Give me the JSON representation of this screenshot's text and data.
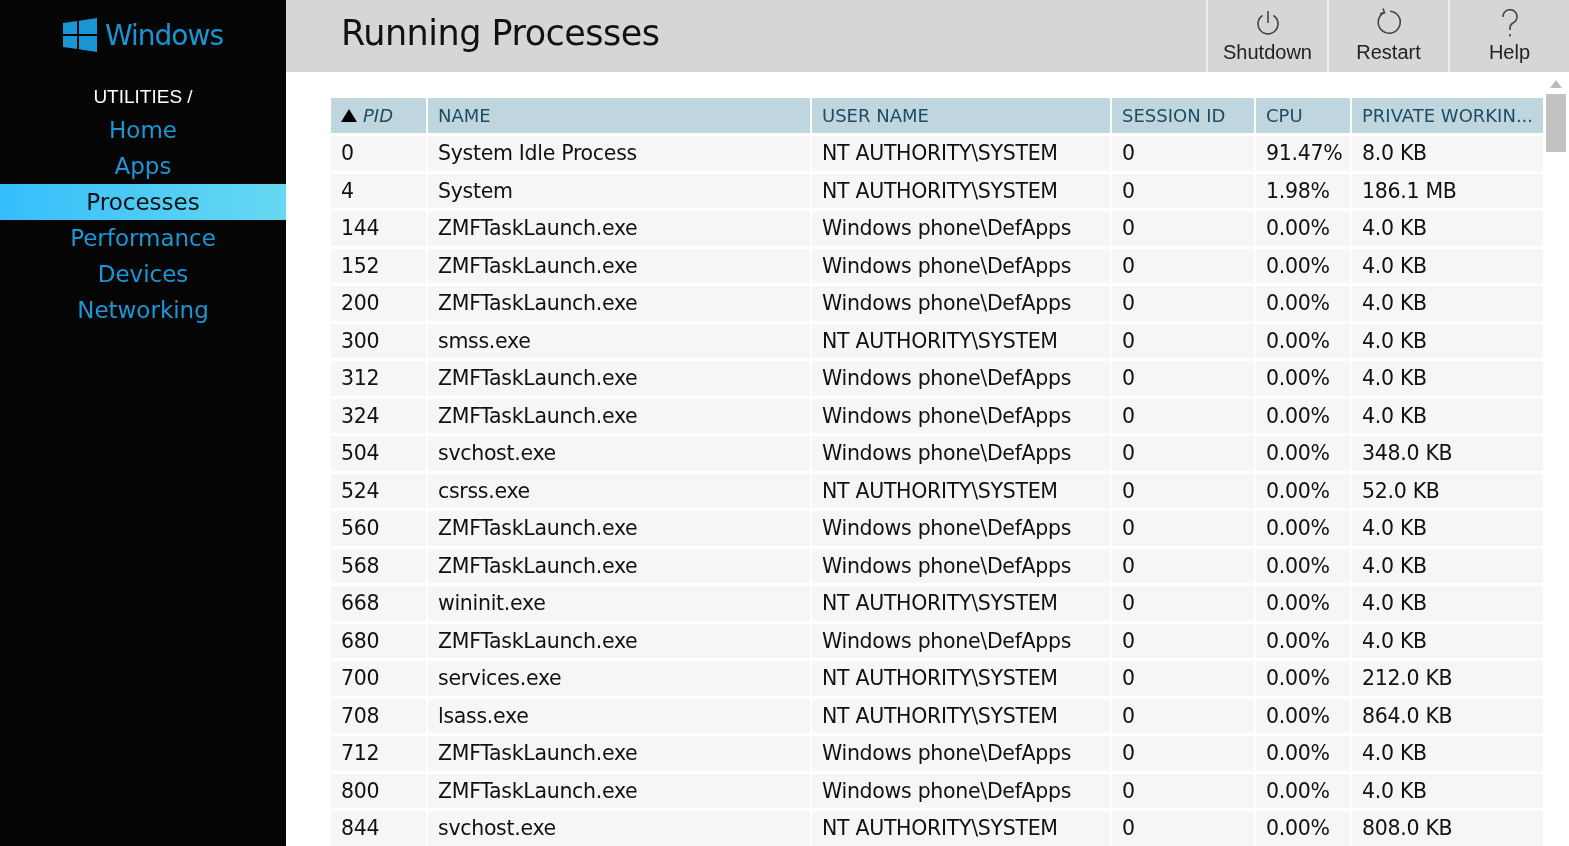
{
  "sidebar": {
    "brand": "Windows",
    "section": "UTILITIES /",
    "items": [
      {
        "label": "Home",
        "selected": false
      },
      {
        "label": "Apps",
        "selected": false
      },
      {
        "label": "Processes",
        "selected": true
      },
      {
        "label": "Performance",
        "selected": false
      },
      {
        "label": "Devices",
        "selected": false
      },
      {
        "label": "Networking",
        "selected": false
      }
    ]
  },
  "header": {
    "title": "Running Processes",
    "buttons": [
      {
        "kind": "power",
        "label": "Shutdown"
      },
      {
        "kind": "restart",
        "label": "Restart"
      },
      {
        "kind": "help",
        "label": "Help"
      }
    ]
  },
  "table": {
    "columns": [
      {
        "label": "PID",
        "sorted": true
      },
      {
        "label": "NAME",
        "sorted": false
      },
      {
        "label": "USER NAME",
        "sorted": false
      },
      {
        "label": "SESSION ID",
        "sorted": false
      },
      {
        "label": "CPU",
        "sorted": false
      },
      {
        "label": "PRIVATE WORKIN...",
        "sorted": false
      }
    ],
    "rows": [
      [
        "0",
        "System Idle Process",
        "NT AUTHORITY\\SYSTEM",
        "0",
        "91.47%",
        "8.0 KB"
      ],
      [
        "4",
        "System",
        "NT AUTHORITY\\SYSTEM",
        "0",
        "1.98%",
        "186.1 MB"
      ],
      [
        "144",
        "ZMFTaskLaunch.exe",
        "Windows phone\\DefApps",
        "0",
        "0.00%",
        "4.0 KB"
      ],
      [
        "152",
        "ZMFTaskLaunch.exe",
        "Windows phone\\DefApps",
        "0",
        "0.00%",
        "4.0 KB"
      ],
      [
        "200",
        "ZMFTaskLaunch.exe",
        "Windows phone\\DefApps",
        "0",
        "0.00%",
        "4.0 KB"
      ],
      [
        "300",
        "smss.exe",
        "NT AUTHORITY\\SYSTEM",
        "0",
        "0.00%",
        "4.0 KB"
      ],
      [
        "312",
        "ZMFTaskLaunch.exe",
        "Windows phone\\DefApps",
        "0",
        "0.00%",
        "4.0 KB"
      ],
      [
        "324",
        "ZMFTaskLaunch.exe",
        "Windows phone\\DefApps",
        "0",
        "0.00%",
        "4.0 KB"
      ],
      [
        "504",
        "svchost.exe",
        "Windows phone\\DefApps",
        "0",
        "0.00%",
        "348.0 KB"
      ],
      [
        "524",
        "csrss.exe",
        "NT AUTHORITY\\SYSTEM",
        "0",
        "0.00%",
        "52.0 KB"
      ],
      [
        "560",
        "ZMFTaskLaunch.exe",
        "Windows phone\\DefApps",
        "0",
        "0.00%",
        "4.0 KB"
      ],
      [
        "568",
        "ZMFTaskLaunch.exe",
        "Windows phone\\DefApps",
        "0",
        "0.00%",
        "4.0 KB"
      ],
      [
        "668",
        "wininit.exe",
        "NT AUTHORITY\\SYSTEM",
        "0",
        "0.00%",
        "4.0 KB"
      ],
      [
        "680",
        "ZMFTaskLaunch.exe",
        "Windows phone\\DefApps",
        "0",
        "0.00%",
        "4.0 KB"
      ],
      [
        "700",
        "services.exe",
        "NT AUTHORITY\\SYSTEM",
        "0",
        "0.00%",
        "212.0 KB"
      ],
      [
        "708",
        "lsass.exe",
        "NT AUTHORITY\\SYSTEM",
        "0",
        "0.00%",
        "864.0 KB"
      ],
      [
        "712",
        "ZMFTaskLaunch.exe",
        "Windows phone\\DefApps",
        "0",
        "0.00%",
        "4.0 KB"
      ],
      [
        "800",
        "ZMFTaskLaunch.exe",
        "Windows phone\\DefApps",
        "0",
        "0.00%",
        "4.0 KB"
      ],
      [
        "844",
        "svchost.exe",
        "NT AUTHORITY\\SYSTEM",
        "0",
        "0.00%",
        "808.0 KB"
      ]
    ]
  }
}
